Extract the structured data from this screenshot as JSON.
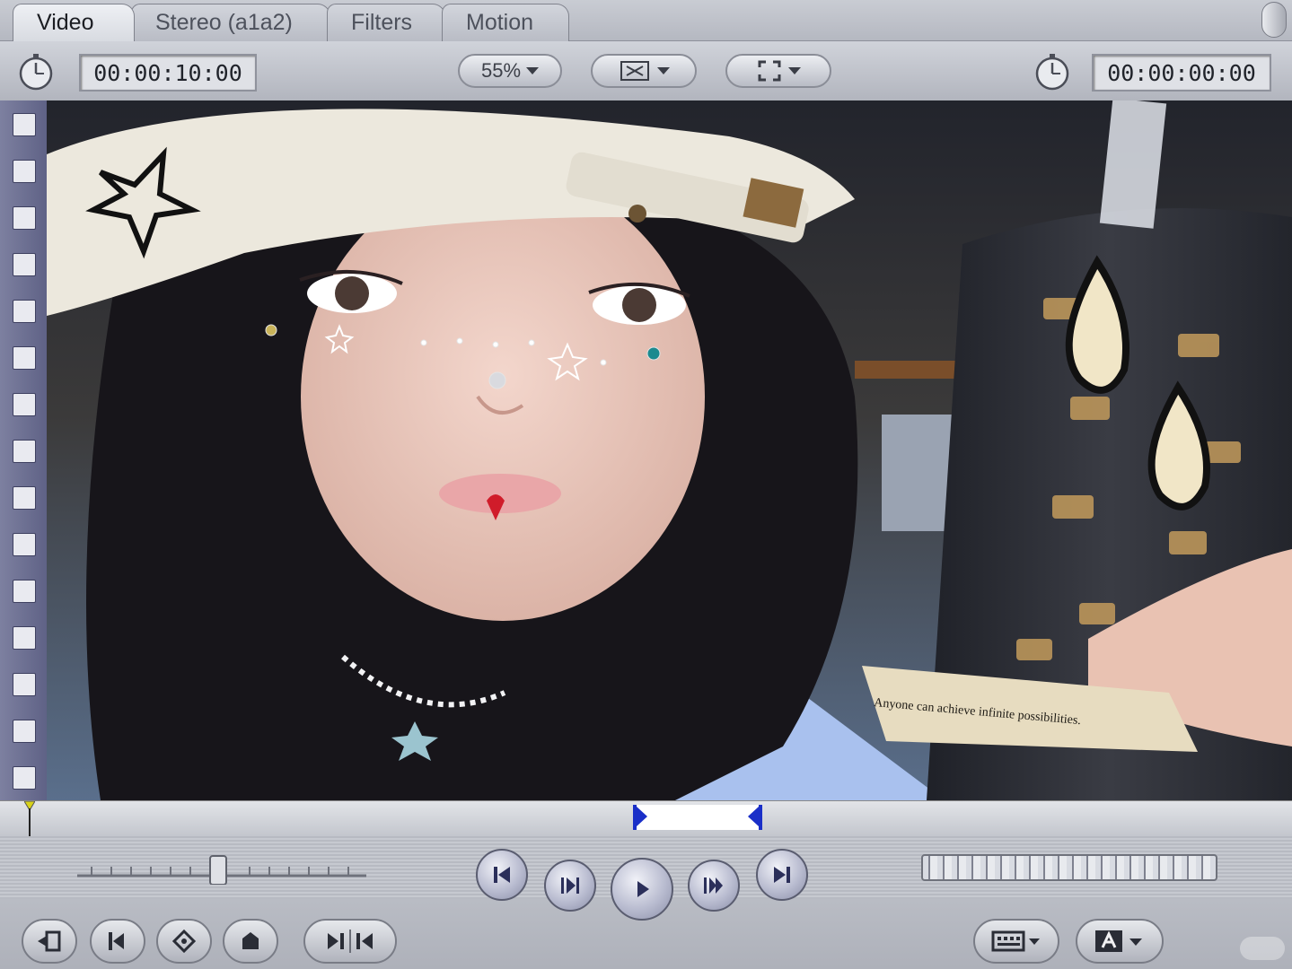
{
  "tabs": [
    {
      "label": "Video",
      "active": true
    },
    {
      "label": "Stereo (a1a2)",
      "active": false
    },
    {
      "label": "Filters",
      "active": false
    },
    {
      "label": "Motion",
      "active": false
    }
  ],
  "toolbar": {
    "duration_timecode": "00:00:10:00",
    "zoom_label": "55%",
    "current_timecode": "00:00:00:00",
    "icons": [
      "stopwatch-icon",
      "zoom-popup",
      "view-mode-popup",
      "overlay-popup",
      "stopwatch-icon"
    ]
  },
  "viewer": {
    "note_text": "Anyone can achieve infinite possibilities.",
    "content": "video frame"
  },
  "scrubber": {
    "playhead_fraction": 0.0,
    "in_fraction": 0.49,
    "out_fraction": 0.59
  },
  "transport": {
    "buttons": [
      "go-to-in-icon",
      "play-in-to-out-icon",
      "play-icon",
      "play-around-icon",
      "go-to-out-icon"
    ],
    "shuttle_fraction": 0.5
  },
  "bottom_buttons": [
    "match-frame-icon",
    "mark-in-out-icon",
    "add-keyframe-icon",
    "add-marker-icon",
    "mark-in-out-split-icon",
    "recent-clips-icon",
    "generator-icon"
  ],
  "colors": {
    "accent": "#1a2fc8",
    "chrome": "#b5b8c1",
    "filmstrip": "#6a6d90"
  }
}
